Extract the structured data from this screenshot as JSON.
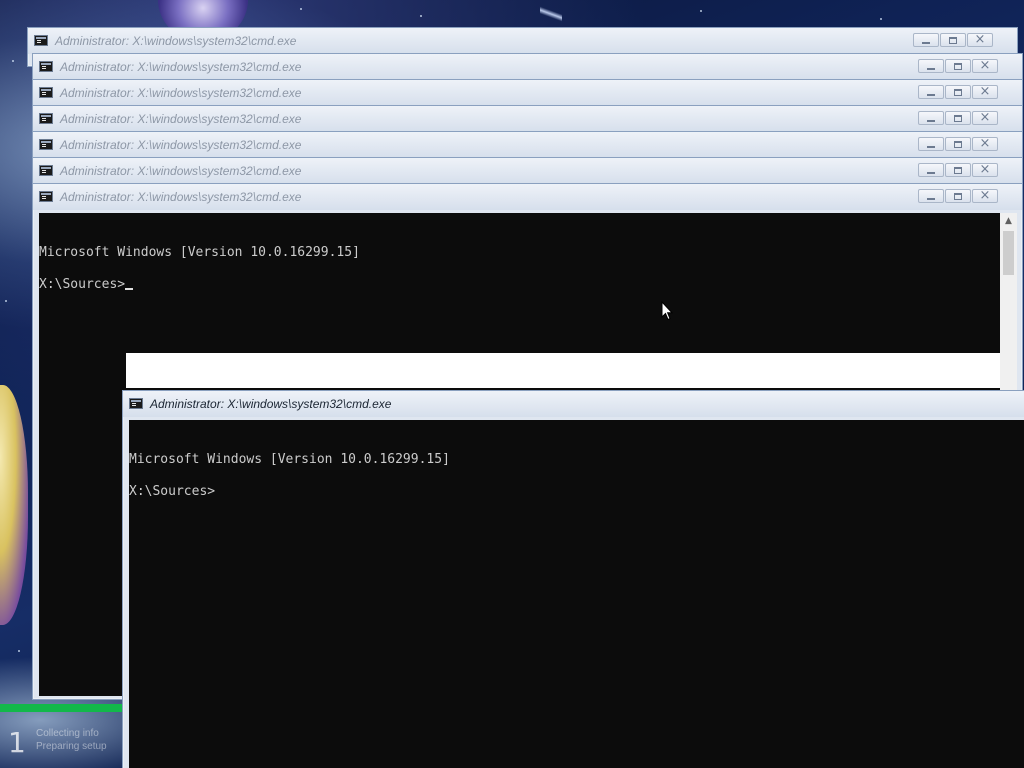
{
  "windows": {
    "stack": [
      {
        "title": "Administrator: X:\\windows\\system32\\cmd.exe"
      },
      {
        "title": "Administrator: X:\\windows\\system32\\cmd.exe"
      },
      {
        "title": "Administrator: X:\\windows\\system32\\cmd.exe"
      },
      {
        "title": "Administrator: X:\\windows\\system32\\cmd.exe"
      },
      {
        "title": "Administrator: X:\\windows\\system32\\cmd.exe"
      },
      {
        "title": "Administrator: X:\\windows\\system32\\cmd.exe"
      }
    ],
    "back": {
      "title": "Administrator: X:\\windows\\system32\\cmd.exe",
      "lines": [
        "Microsoft Windows [Version 10.0.16299.15]",
        "",
        "X:\\Sources>"
      ]
    },
    "front": {
      "title": "Administrator: X:\\windows\\system32\\cmd.exe",
      "lines": [
        "Microsoft Windows [Version 10.0.16299.15]",
        "",
        "X:\\Sources>"
      ]
    }
  },
  "setup_progress": {
    "step_number": "1",
    "text_line1": "Collecting info",
    "text_line2": "Preparing setup"
  },
  "colors": {
    "console_bg": "#0c0c0c",
    "console_text": "#cccccc",
    "titlebar": "#dfe6f0",
    "progress": "#12b84a"
  },
  "icons": {
    "window_icon": "cmd-icon",
    "minimize": "minimize-icon",
    "maximize": "maximize-icon",
    "close": "close-icon",
    "pointer": "mouse-pointer-icon"
  }
}
